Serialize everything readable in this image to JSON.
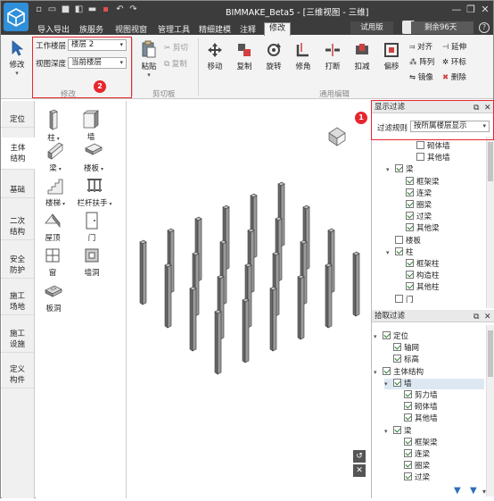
{
  "titlebar": {
    "title": "BIMMAKE_Beta5 - [三维视图 - 三维]",
    "window_controls": [
      "minimize-icon",
      "restore-icon",
      "close-icon"
    ]
  },
  "menubar": {
    "items": [
      "导入导出",
      "族服务",
      "视图视窗",
      "管理工具",
      "精细建模",
      "注释",
      "修改"
    ],
    "active": "修改",
    "trial_label": "试用版",
    "remaining": "剩余96天",
    "help": "?"
  },
  "ribbon": {
    "modify_button": "修改",
    "work_level_label": "工作楼层",
    "work_level_value": "楼层 2",
    "view_depth_label": "视图深度",
    "view_depth_value": "当前楼层",
    "group_modify": "修改",
    "paste": "粘贴",
    "cut": "剪切",
    "copy_small": "复制",
    "group_clipboard": "剪切板",
    "move": "移动",
    "copy": "复制",
    "rotate": "旋转",
    "trim": "修角",
    "break": "打断",
    "buckle": "扣减",
    "offset": "偏移",
    "align": "对齐",
    "extend": "延伸",
    "array": "阵列",
    "loop": "环标",
    "mirror": "镜像",
    "delete": "删除",
    "group_general": "通用编辑"
  },
  "annotations": {
    "badge1": "1",
    "badge2": "2"
  },
  "leftnav": {
    "items": [
      "定位",
      "主体\n结构",
      "基础",
      "二次\n结构",
      "安全\n防护",
      "施工\n场地",
      "施工\n设施",
      "定义\n构件"
    ],
    "active": "主体\n结构"
  },
  "components": {
    "items": [
      "柱",
      "墙",
      "梁",
      "楼板",
      "楼梯",
      "栏杆扶手",
      "屋顶",
      "门",
      "窗",
      "墙洞",
      "板洞"
    ]
  },
  "filter_panel": {
    "title": "显示过滤",
    "rule_label": "过滤规则",
    "rule_value": "按所属楼层显示",
    "tree": [
      {
        "label": "砌体墙",
        "checked": false,
        "level": 3
      },
      {
        "label": "其他墙",
        "checked": false,
        "level": 3
      },
      {
        "label": "梁",
        "checked": true,
        "level": 1,
        "expanded": true
      },
      {
        "label": "框架梁",
        "checked": true,
        "level": 2
      },
      {
        "label": "连梁",
        "checked": true,
        "level": 2
      },
      {
        "label": "圈梁",
        "checked": true,
        "level": 2
      },
      {
        "label": "过梁",
        "checked": true,
        "level": 2
      },
      {
        "label": "其他梁",
        "checked": true,
        "level": 2
      },
      {
        "label": "楼板",
        "checked": false,
        "level": 1
      },
      {
        "label": "柱",
        "checked": true,
        "level": 1,
        "expanded": true
      },
      {
        "label": "框架柱",
        "checked": true,
        "level": 2
      },
      {
        "label": "构造柱",
        "checked": true,
        "level": 2
      },
      {
        "label": "其他柱",
        "checked": true,
        "level": 2
      },
      {
        "label": "门",
        "checked": false,
        "level": 1
      }
    ]
  },
  "pick_panel": {
    "title": "拾取过滤",
    "tree": [
      {
        "label": "定位",
        "checked": true,
        "level": 0,
        "expanded": true
      },
      {
        "label": "轴网",
        "checked": true,
        "level": 1
      },
      {
        "label": "标高",
        "checked": true,
        "level": 1
      },
      {
        "label": "主体结构",
        "checked": true,
        "level": 0,
        "expanded": true
      },
      {
        "label": "墙",
        "checked": true,
        "level": 1,
        "expanded": true,
        "selected": true
      },
      {
        "label": "剪力墙",
        "checked": true,
        "level": 2
      },
      {
        "label": "砌体墙",
        "checked": true,
        "level": 2
      },
      {
        "label": "其他墙",
        "checked": true,
        "level": 2
      },
      {
        "label": "梁",
        "checked": true,
        "level": 1,
        "expanded": true
      },
      {
        "label": "框架梁",
        "checked": true,
        "level": 2
      },
      {
        "label": "连梁",
        "checked": true,
        "level": 2
      },
      {
        "label": "圈梁",
        "checked": true,
        "level": 2
      },
      {
        "label": "过梁",
        "checked": true,
        "level": 2
      }
    ]
  },
  "viewport": {
    "view_cube": "view-cube-icon",
    "nav_buttons": [
      "undo-view-icon",
      "close-view-icon"
    ]
  },
  "colors": {
    "titlebar": "#3c3c3c",
    "accent": "#2f8fd8",
    "highlight": "#e8262e",
    "column_front": "#6b6b6b",
    "column_side": "#9a9a9a",
    "column_top": "#bdbdbd"
  }
}
